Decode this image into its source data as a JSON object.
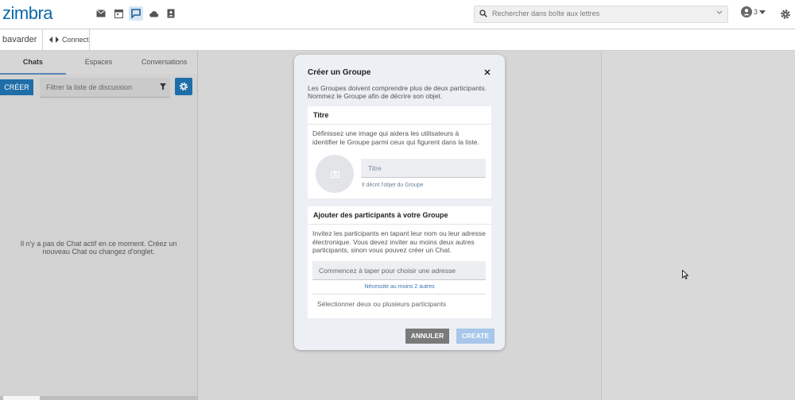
{
  "app": {
    "logo": "zimbra",
    "apps": [
      "mail-icon",
      "calendar-icon",
      "chat-icon",
      "cloud-icon",
      "contacts-icon"
    ],
    "active_app": "chat-icon",
    "search_placeholder": "Rechercher dans boîte aux lettres",
    "user_badge": "3"
  },
  "subbar": {
    "title": "bavarder",
    "connect_label": "Connect"
  },
  "left": {
    "tabs": [
      {
        "label": "Chats",
        "active": true
      },
      {
        "label": "Espaces",
        "active": false
      },
      {
        "label": "Conversations",
        "active": false
      }
    ],
    "create_label": "CRÉER",
    "filter_placeholder": "Filtrer la liste de discussion",
    "empty_message": "Il n'y a pas de Chat actif en ce moment. Créez un nouveau Chat ou changez d'onglet."
  },
  "modal": {
    "title": "Créer un Groupe",
    "description": "Les Groupes doivent comprendre plus de deux participants. Nommez le Groupe afin de décrire son objet.",
    "title_card": {
      "header": "Titre",
      "text": "Définissez une image qui aidera les utilisateurs à identifier le Groupe parmi ceux qui figurent dans la liste.",
      "input_placeholder": "Titre",
      "help": "Il décrit l'objet du Groupe"
    },
    "participants_card": {
      "header": "Ajouter des participants à votre Groupe",
      "text": "Invitez les participants en tapant leur nom ou leur adresse électronique. Vous devez inviter au moins deux autres participants, sinon vous pouvez créer un Chat.",
      "input_placeholder": "Commencez à taper pour choisir une adresse",
      "help": "Nécessite au moins 2 autres",
      "select_label": "Sélectionner deux ou plusieurs participants"
    },
    "cancel_label": "ANNULER",
    "create_label": "CREATE"
  }
}
